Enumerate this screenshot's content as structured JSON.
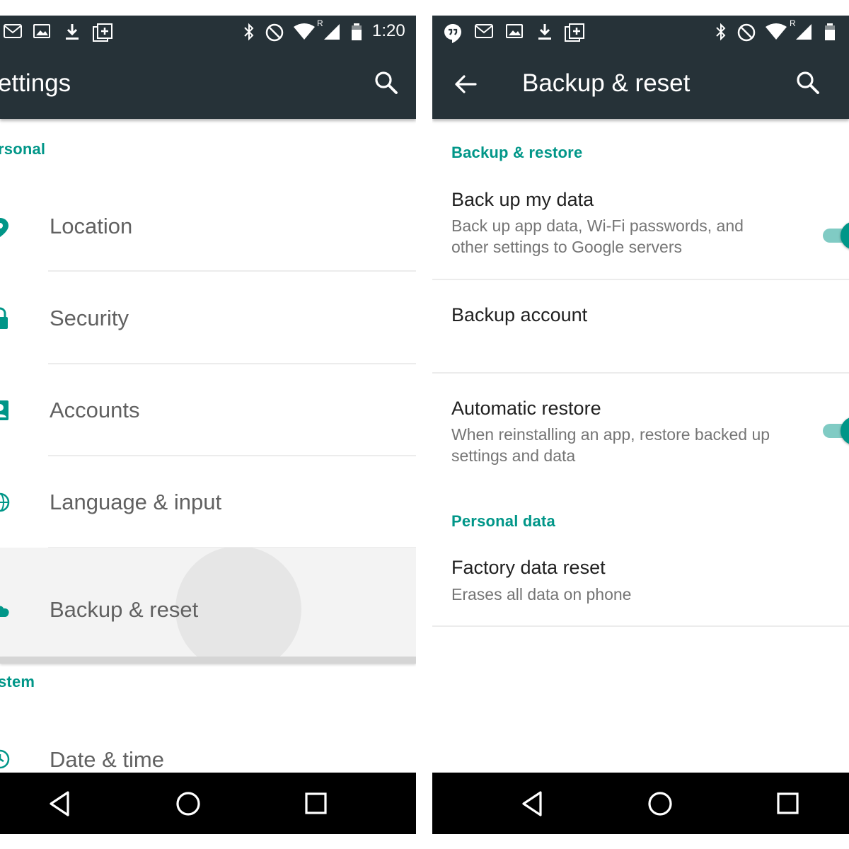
{
  "status_bar": {
    "time": "1:20",
    "network_indicator": "R"
  },
  "settings_screen": {
    "title": "ettings",
    "sections": [
      {
        "header": "rsonal",
        "items": [
          {
            "label": "Location",
            "icon": "location-icon"
          },
          {
            "label": "Security",
            "icon": "lock-icon"
          },
          {
            "label": "Accounts",
            "icon": "account-icon"
          },
          {
            "label": "Language & input",
            "icon": "globe-icon"
          },
          {
            "label": "Backup & reset",
            "icon": "cloud-icon",
            "state": "pressed"
          }
        ]
      },
      {
        "header": "stem",
        "items": [
          {
            "label": "Date & time",
            "icon": "clock-icon"
          }
        ]
      }
    ]
  },
  "backup_screen": {
    "title": "Backup & reset",
    "sections": [
      {
        "header": "Backup & restore",
        "items": [
          {
            "title": "Back up my data",
            "summary": "Back up app data, Wi-Fi passwords, and other settings to Google servers",
            "toggle": true
          },
          {
            "title": "Backup account",
            "summary": ""
          },
          {
            "title": "Automatic restore",
            "summary": "When reinstalling an app, restore backed up settings and data",
            "toggle": true
          }
        ]
      },
      {
        "header": "Personal data",
        "items": [
          {
            "title": "Factory data reset",
            "summary": "Erases all data on phone"
          }
        ]
      }
    ]
  },
  "icons": {
    "search": "search-icon",
    "back": "arrow-back-icon",
    "nav_back": "nav-back-icon",
    "nav_home": "nav-home-icon",
    "nav_recents": "nav-recents-icon"
  },
  "colors": {
    "app_bar": "#263238",
    "accent": "#009688",
    "accent_light": "#80cbc4",
    "nav_bar": "#000000"
  }
}
